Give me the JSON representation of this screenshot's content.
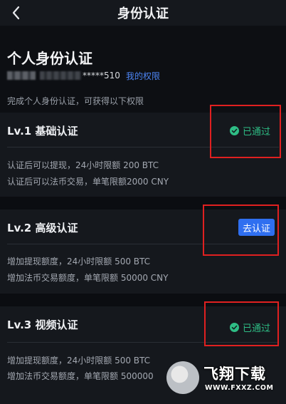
{
  "header": {
    "title": "身份认证"
  },
  "profile": {
    "title": "个人身份认证",
    "user_id_masked": "*****510",
    "rights_link": "我的权限",
    "hint": "完成个人身份认证，可获得以下权限"
  },
  "levels": [
    {
      "title": "Lv.1 基础认证",
      "status": "已通过",
      "desc": [
        "认证后可以提现，24小时限额 200 BTC",
        "认证后可以法币交易，单笔限额2000 CNY"
      ]
    },
    {
      "title": "Lv.2 高级认证",
      "action": "去认证",
      "desc": [
        "增加提现额度，24小时限额 500 BTC",
        "增加法币交易额度，单笔限额 50000 CNY"
      ]
    },
    {
      "title": "Lv.3 视频认证",
      "status": "已通过",
      "desc": [
        "增加提现额度，24小时限额 500 BTC",
        "增加法币交易额度，单笔限额 500000"
      ]
    }
  ],
  "watermark": {
    "name": "飞翔下载",
    "url": "WWW.FXXZ.COM"
  },
  "colors": {
    "accent": "#2f6ff0",
    "link": "#4d85f4",
    "success": "#2ebd85",
    "highlight": "#e02020",
    "background": "#0b0d11",
    "card": "#15181d"
  },
  "icons": {
    "back": "chevron-left-icon",
    "passed": "check-circle-icon"
  }
}
